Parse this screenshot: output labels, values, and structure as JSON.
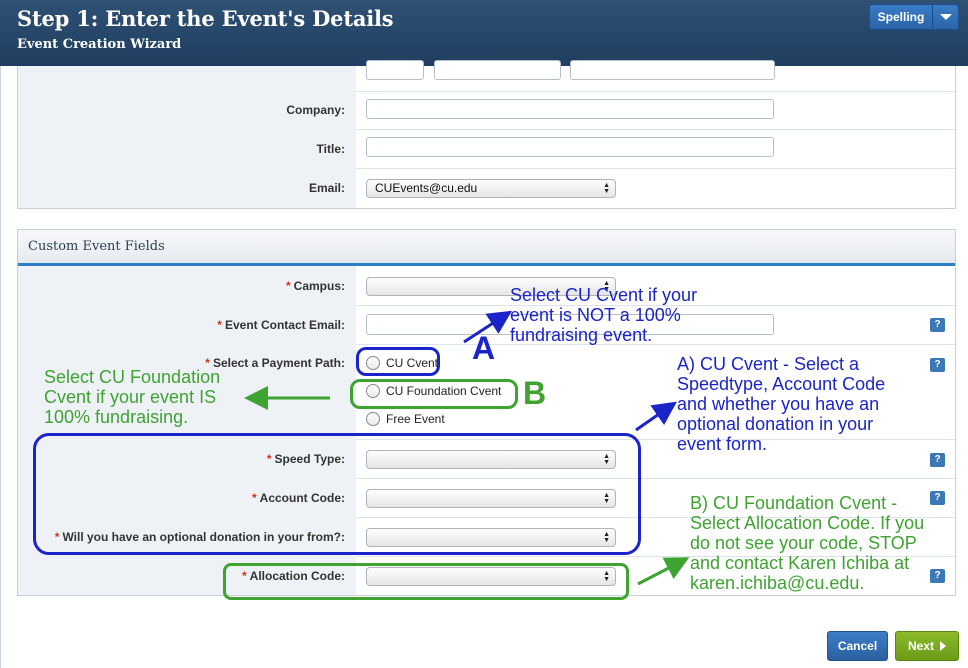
{
  "header": {
    "title": "Step 1: Enter the Event's Details",
    "subtitle": "Event Creation Wizard",
    "spelling_label": "Spelling"
  },
  "contact_fields": {
    "company_label": "Company:",
    "title_label": "Title:",
    "email_label": "Email:",
    "email_value": "CUEvents@cu.edu"
  },
  "custom_fields": {
    "section_title": "Custom Event Fields",
    "required_mark": "*",
    "campus_label": "Campus:",
    "event_contact_email_label": "Event Contact Email:",
    "payment_path_label": "Select a Payment Path:",
    "payment_options": [
      "CU Cvent",
      "CU Foundation Cvent",
      "Free Event"
    ],
    "speed_type_label": "Speed Type:",
    "account_code_label": "Account Code:",
    "donation_label": "Will you have an optional donation in your from?:",
    "allocation_code_label": "Allocation Code:",
    "help_glyph": "?"
  },
  "annotations": {
    "a_letter": "A",
    "b_letter": "B",
    "select_cu_cvent": [
      "Select CU Cvent if your",
      "event is NOT a 100%",
      "fundraising event."
    ],
    "select_foundation": [
      "Select CU Foundation",
      "Cvent if your event IS",
      "100% fundraising."
    ],
    "a_note": [
      "A) CU Cvent - Select a",
      "Speedtype, Account Code",
      "and whether you have an",
      "optional donation in your",
      "event form."
    ],
    "b_note": [
      "B) CU Foundation Cvent -",
      "Select Allocation Code. If you",
      "do not see your code, STOP",
      "and contact Karen Ichiba at",
      "karen.ichiba@cu.edu."
    ],
    "blue_color": "#1a24c9",
    "green_color": "#3fa332"
  },
  "footer": {
    "cancel_label": "Cancel",
    "next_label": "Next"
  }
}
